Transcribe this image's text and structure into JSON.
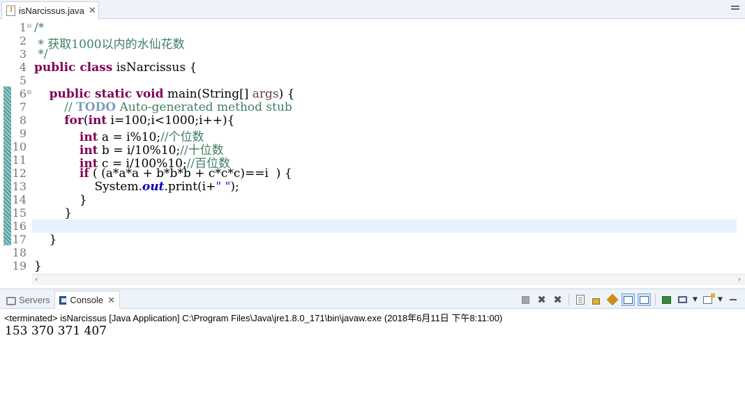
{
  "editor": {
    "tab_label": "isNarcissus.java",
    "tab_close": "✕",
    "line_numbers": [
      "1",
      "2",
      "3",
      "4",
      "5",
      "6",
      "7",
      "8",
      "9",
      "10",
      "11",
      "12",
      "13",
      "14",
      "15",
      "16",
      "17",
      "18",
      "19"
    ],
    "code": {
      "l1": "/*",
      "l2": " * 获取1000以内的水仙花数",
      "l3": " */",
      "l4_kw": "public class",
      "l4_rest": " isNarcissus {",
      "l6_indent": "    ",
      "l6_kw": "public static void",
      "l6_rest": " main(String[] ",
      "l6_var": "args",
      "l6_end": ") {",
      "l7_indent": "        ",
      "l7_cm1": "// ",
      "l7_todo": "TODO",
      "l7_cm2": " Auto-generated method stub",
      "l8_indent": "        ",
      "l8_kw1": "for",
      "l8_p1": "(",
      "l8_kw2": "int",
      "l8_rest": " i=100;i<1000;i++){",
      "l9_indent": "            ",
      "l9_kw": "int",
      "l9_rest": " a = i%10;",
      "l9_cm": "//个位数",
      "l10_indent": "            ",
      "l10_kw": "int",
      "l10_rest": " b = i/10%10;",
      "l10_cm": "//十位数",
      "l11_indent": "            ",
      "l11_kw": "int",
      "l11_rest": " c = i/100%10;",
      "l11_cm": "//百位数",
      "l12_indent": "            ",
      "l12_kw": "if",
      "l12_rest": " ( (a*a*a + b*b*b + c*c*c)==i  ) {",
      "l13_indent": "                ",
      "l13_a": "System.",
      "l13_fld": "out",
      "l13_b": ".print(i+",
      "l13_str": "\" \"",
      "l13_c": ");",
      "l14": "            }",
      "l15": "        }",
      "l17": "    }",
      "l19": "}"
    }
  },
  "console": {
    "tab_servers": "Servers",
    "tab_console": "Console",
    "tab_close": "✕",
    "terminated_line": "<terminated> isNarcissus [Java Application] C:\\Program Files\\Java\\jre1.8.0_171\\bin\\javaw.exe (2018年6月11日 下午8:11:00)",
    "output": "153 370 371 407"
  },
  "icons": {
    "java-file": "java-file-icon",
    "servers": "servers-icon",
    "console": "console-icon",
    "terminate": "stop-icon",
    "remove-launch": "remove-icon",
    "remove-all": "remove-all-icon"
  }
}
